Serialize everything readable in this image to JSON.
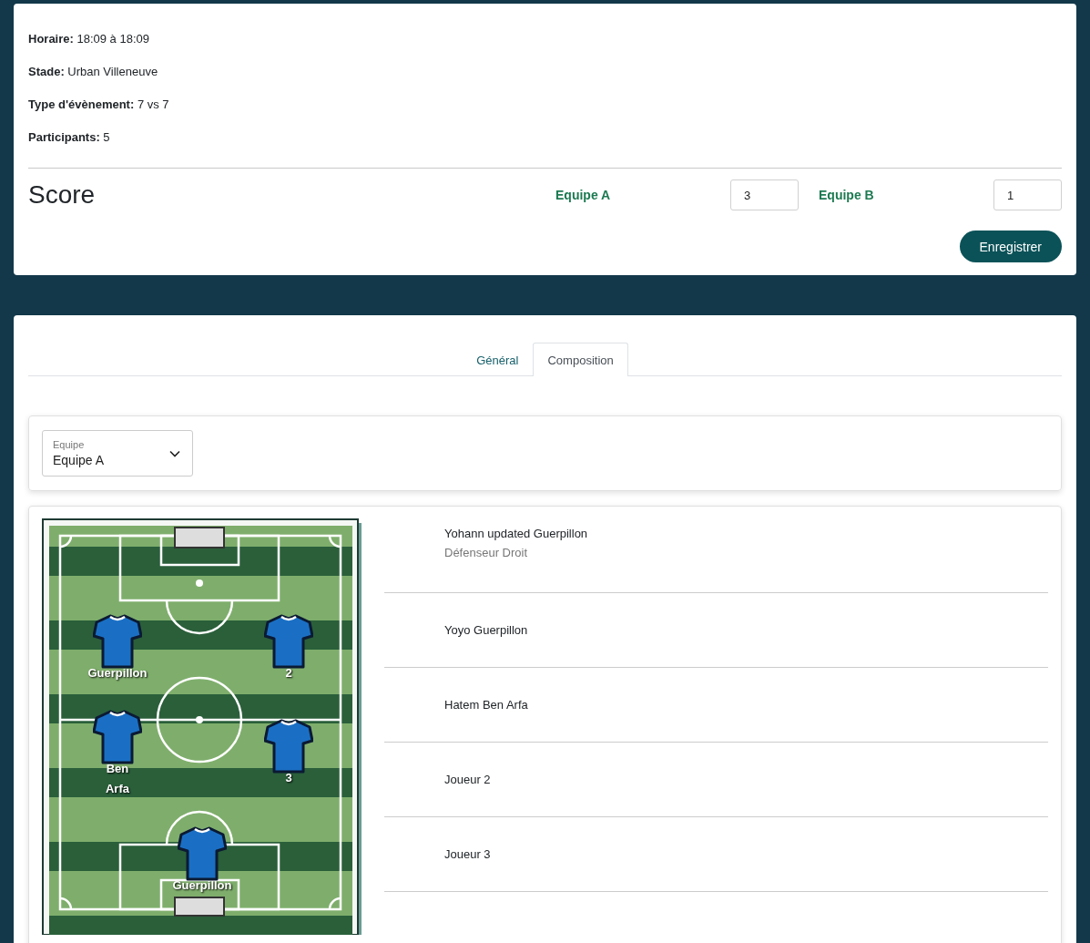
{
  "event": {
    "details": [
      {
        "label": "Horaire:",
        "value": "18:09 à 18:09"
      },
      {
        "label": "Stade:",
        "value": "Urban Villeneuve"
      },
      {
        "label": "Type d'évènement:",
        "value": "7 vs 7"
      },
      {
        "label": "Participants:",
        "value": "5"
      }
    ]
  },
  "score": {
    "title": "Score",
    "teams": [
      {
        "name": "Equipe A",
        "value": "3"
      },
      {
        "name": "Equipe B",
        "value": "1"
      }
    ],
    "save_button": "Enregistrer"
  },
  "tabs": [
    {
      "label": "Général",
      "selected": false
    },
    {
      "label": "Composition",
      "selected": true
    }
  ],
  "team_select": {
    "label": "Equipe",
    "value": "Equipe A"
  },
  "pitch_players": [
    {
      "label": "Guerpillon"
    },
    {
      "label": "2"
    },
    {
      "label": "Ben Arfa"
    },
    {
      "label": "3"
    },
    {
      "label": "Guerpillon"
    }
  ],
  "players": [
    {
      "name": "Yohann updated Guerpillon",
      "position": "Défenseur Droit"
    },
    {
      "name": "Yoyo Guerpillon"
    },
    {
      "name": "Hatem Ben Arfa"
    },
    {
      "name": "Joueur 2"
    },
    {
      "name": "Joueur 3"
    }
  ]
}
